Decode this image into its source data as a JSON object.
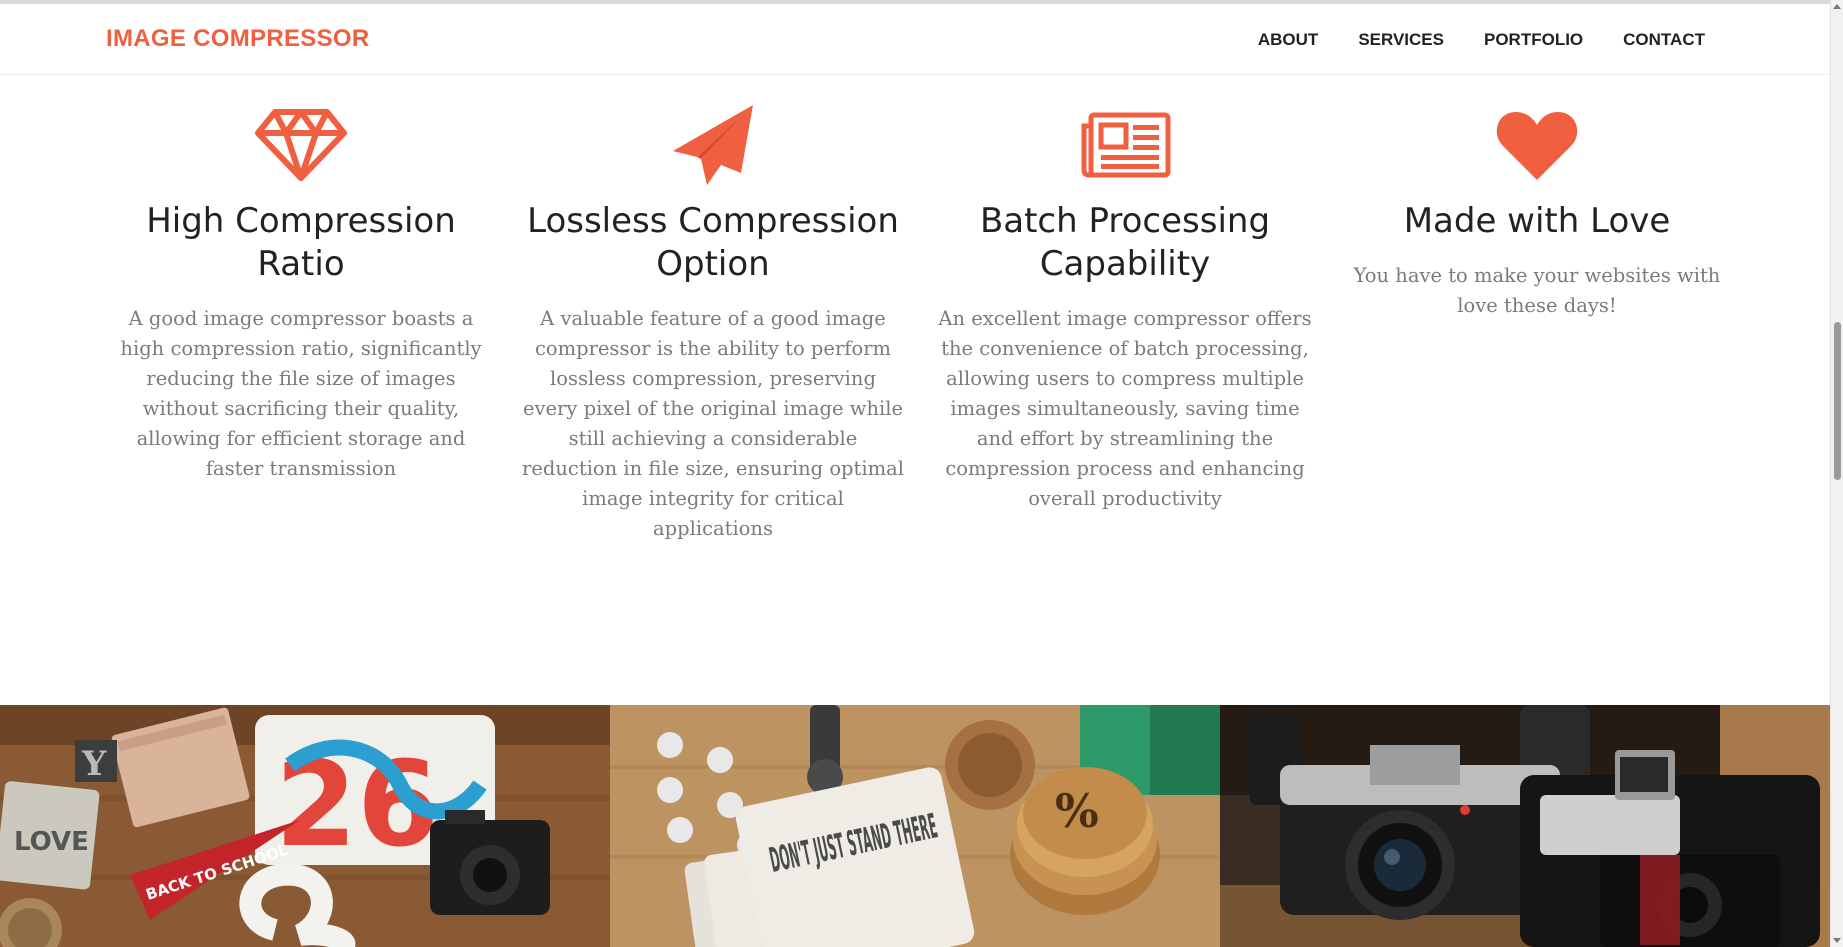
{
  "navbar": {
    "brand": "IMAGE COMPRESSOR",
    "links": [
      "ABOUT",
      "SERVICES",
      "PORTFOLIO",
      "CONTACT"
    ]
  },
  "features": [
    {
      "icon": "diamond-icon",
      "title": "High Compression Ratio",
      "text": "A good image compressor boasts a high compression ratio, significantly reducing the file size of images without sacrificing their quality, allowing for efficient storage and faster transmission"
    },
    {
      "icon": "paper-plane-icon",
      "title": "Lossless Compression Option",
      "text": "A valuable feature of a good image compressor is the ability to perform lossless compression, preserving every pixel of the original image while still achieving a considerable reduction in file size, ensuring optimal image integrity for critical applications"
    },
    {
      "icon": "newspaper-icon",
      "title": "Batch Processing Capability",
      "text": "An excellent image compressor offers the convenience of batch processing, allowing users to compress multiple images simultaneously, saving time and effort by streamlining the compression process and enhancing overall productivity"
    },
    {
      "icon": "heart-icon",
      "title": "Made with Love",
      "text": "You have to make your websites with love these days!"
    }
  ],
  "gallery": {
    "tiles": [
      {
        "name": "desk-flatlay-photo",
        "tshirt_text": "26",
        "pennant_text": "BACK TO SCHOOL",
        "label_text": "LOVE"
      },
      {
        "name": "coaster-photo",
        "coaster_text": "DON'T JUST STAND THERE"
      },
      {
        "name": "vintage-cameras-photo"
      }
    ]
  },
  "colors": {
    "accent": "#f05f40",
    "heading": "#222222",
    "body_text": "#7b7b7b"
  }
}
